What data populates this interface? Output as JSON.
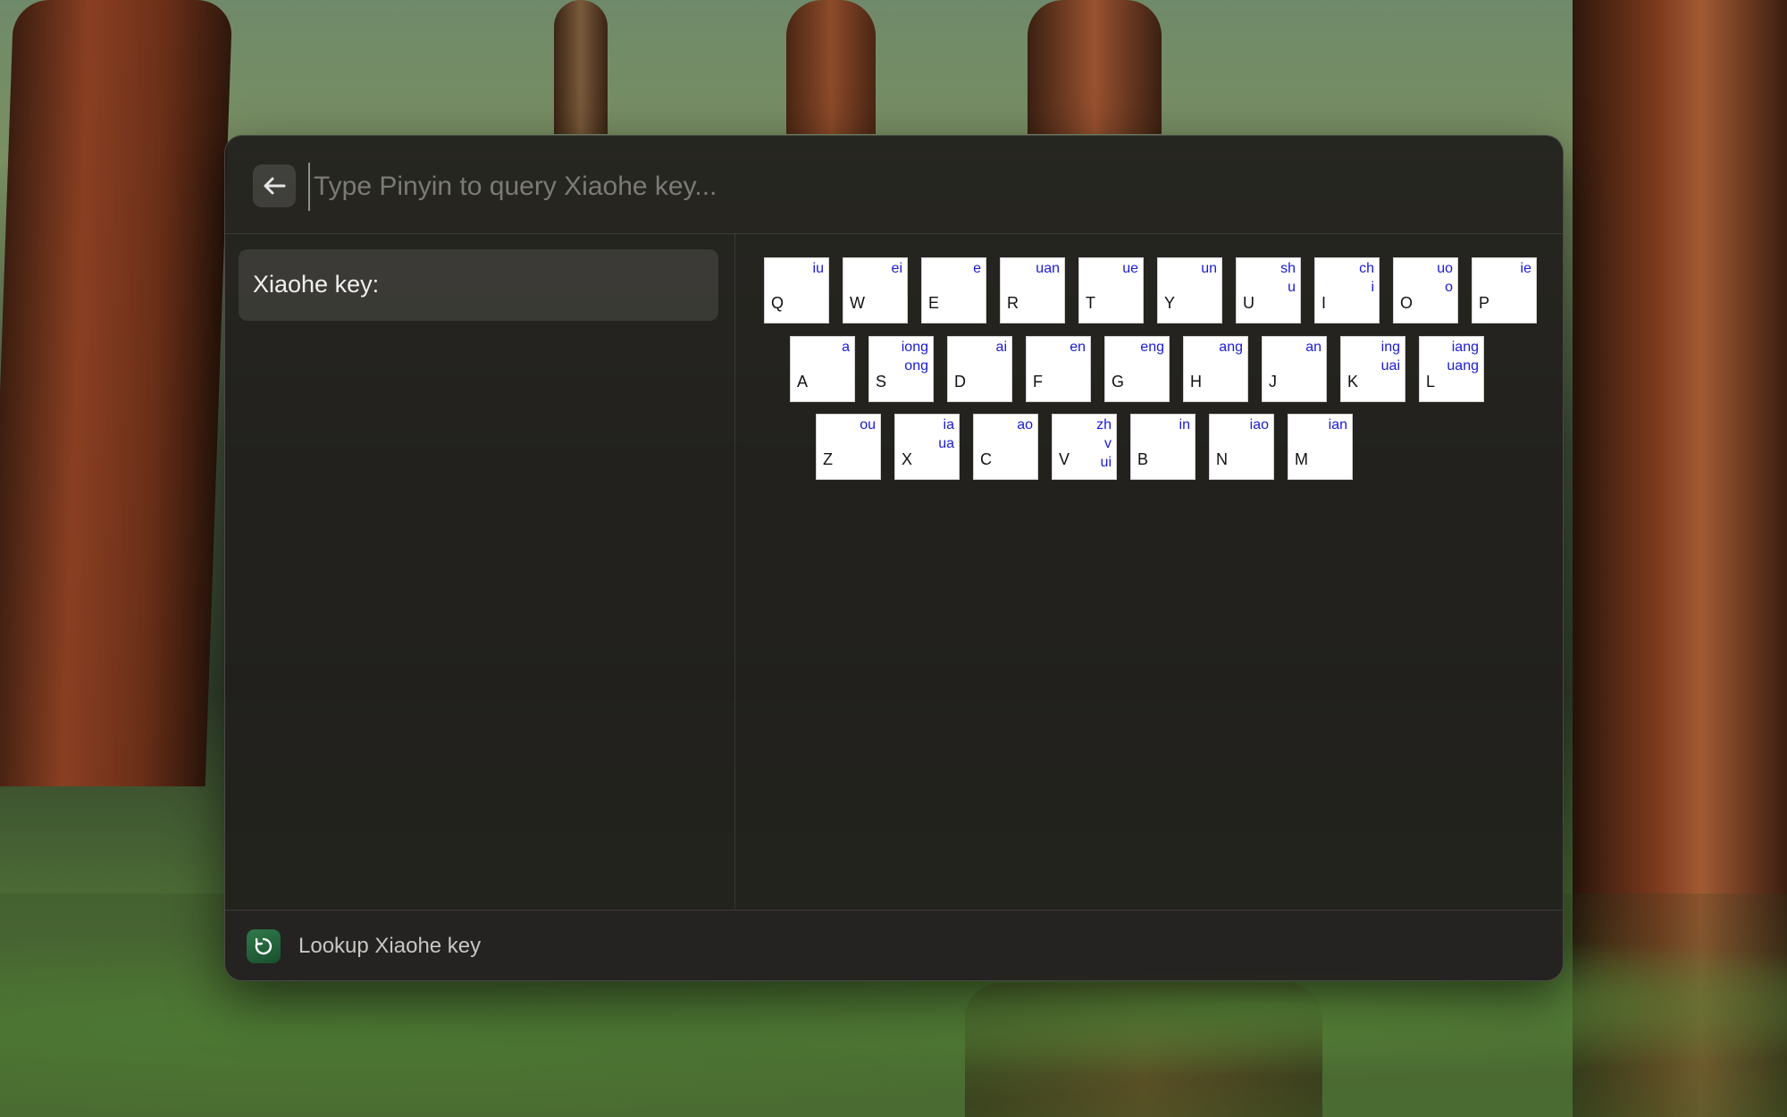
{
  "search": {
    "placeholder": "Type Pinyin to query Xiaohe key...",
    "value": ""
  },
  "result": {
    "label": "Xiaohe key:"
  },
  "keyboard": {
    "rows": [
      [
        {
          "letter": "Q",
          "finals": [
            "iu"
          ]
        },
        {
          "letter": "W",
          "finals": [
            "ei"
          ]
        },
        {
          "letter": "E",
          "finals": [
            "e"
          ]
        },
        {
          "letter": "R",
          "finals": [
            "uan"
          ]
        },
        {
          "letter": "T",
          "finals": [
            "ue"
          ]
        },
        {
          "letter": "Y",
          "finals": [
            "un"
          ]
        },
        {
          "letter": "U",
          "finals": [
            "sh",
            "u"
          ]
        },
        {
          "letter": "I",
          "finals": [
            "ch",
            "i"
          ]
        },
        {
          "letter": "O",
          "finals": [
            "uo",
            "o"
          ]
        },
        {
          "letter": "P",
          "finals": [
            "ie"
          ]
        }
      ],
      [
        {
          "letter": "A",
          "finals": [
            "a"
          ]
        },
        {
          "letter": "S",
          "finals": [
            "iong",
            "ong"
          ]
        },
        {
          "letter": "D",
          "finals": [
            "ai"
          ]
        },
        {
          "letter": "F",
          "finals": [
            "en"
          ]
        },
        {
          "letter": "G",
          "finals": [
            "eng"
          ]
        },
        {
          "letter": "H",
          "finals": [
            "ang"
          ]
        },
        {
          "letter": "J",
          "finals": [
            "an"
          ]
        },
        {
          "letter": "K",
          "finals": [
            "ing",
            "uai"
          ]
        },
        {
          "letter": "L",
          "finals": [
            "iang",
            "uang"
          ]
        }
      ],
      [
        {
          "letter": "Z",
          "finals": [
            "ou"
          ]
        },
        {
          "letter": "X",
          "finals": [
            "ia",
            "ua"
          ]
        },
        {
          "letter": "C",
          "finals": [
            "ao"
          ]
        },
        {
          "letter": "V",
          "finals": [
            "zh",
            "v",
            "ui"
          ]
        },
        {
          "letter": "B",
          "finals": [
            "in"
          ]
        },
        {
          "letter": "N",
          "finals": [
            "iao"
          ]
        },
        {
          "letter": "M",
          "finals": [
            "ian"
          ]
        }
      ]
    ]
  },
  "footer": {
    "title": "Lookup Xiaohe key",
    "icon": "app-icon"
  },
  "icons": {
    "back": "arrow-left-icon"
  },
  "colors": {
    "final_text": "#1a1ad6",
    "window_bg": "#201e1c"
  }
}
